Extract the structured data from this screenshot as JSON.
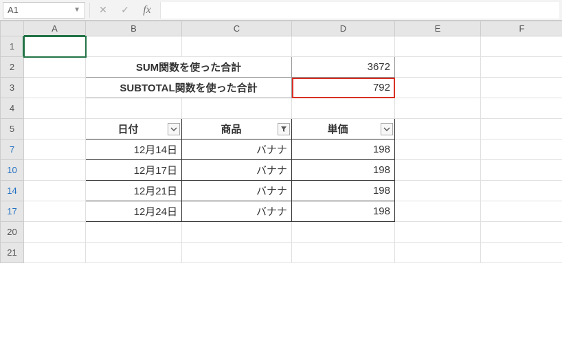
{
  "namebox": {
    "value": "A1"
  },
  "fx_label": "fx",
  "formula": "",
  "columns": [
    "A",
    "B",
    "C",
    "D",
    "E",
    "F"
  ],
  "row_headers": [
    "1",
    "2",
    "3",
    "4",
    "5",
    "7",
    "10",
    "14",
    "17",
    "20",
    "21"
  ],
  "filtered_rows": [
    "7",
    "10",
    "14",
    "17"
  ],
  "summary": {
    "rows": [
      {
        "label": "SUM関数を使った合計",
        "value": "3672",
        "highlight": false
      },
      {
        "label": "SUBTOTAL関数を使った合計",
        "value": "792",
        "highlight": true
      }
    ]
  },
  "table": {
    "headers": {
      "date": {
        "label": "日付",
        "filter": "none"
      },
      "item": {
        "label": "商品",
        "filter": "active"
      },
      "price": {
        "label": "単価",
        "filter": "none"
      }
    },
    "rows": [
      {
        "date": "12月14日",
        "item": "バナナ",
        "price": "198"
      },
      {
        "date": "12月17日",
        "item": "バナナ",
        "price": "198"
      },
      {
        "date": "12月21日",
        "item": "バナナ",
        "price": "198"
      },
      {
        "date": "12月24日",
        "item": "バナナ",
        "price": "198"
      }
    ]
  }
}
